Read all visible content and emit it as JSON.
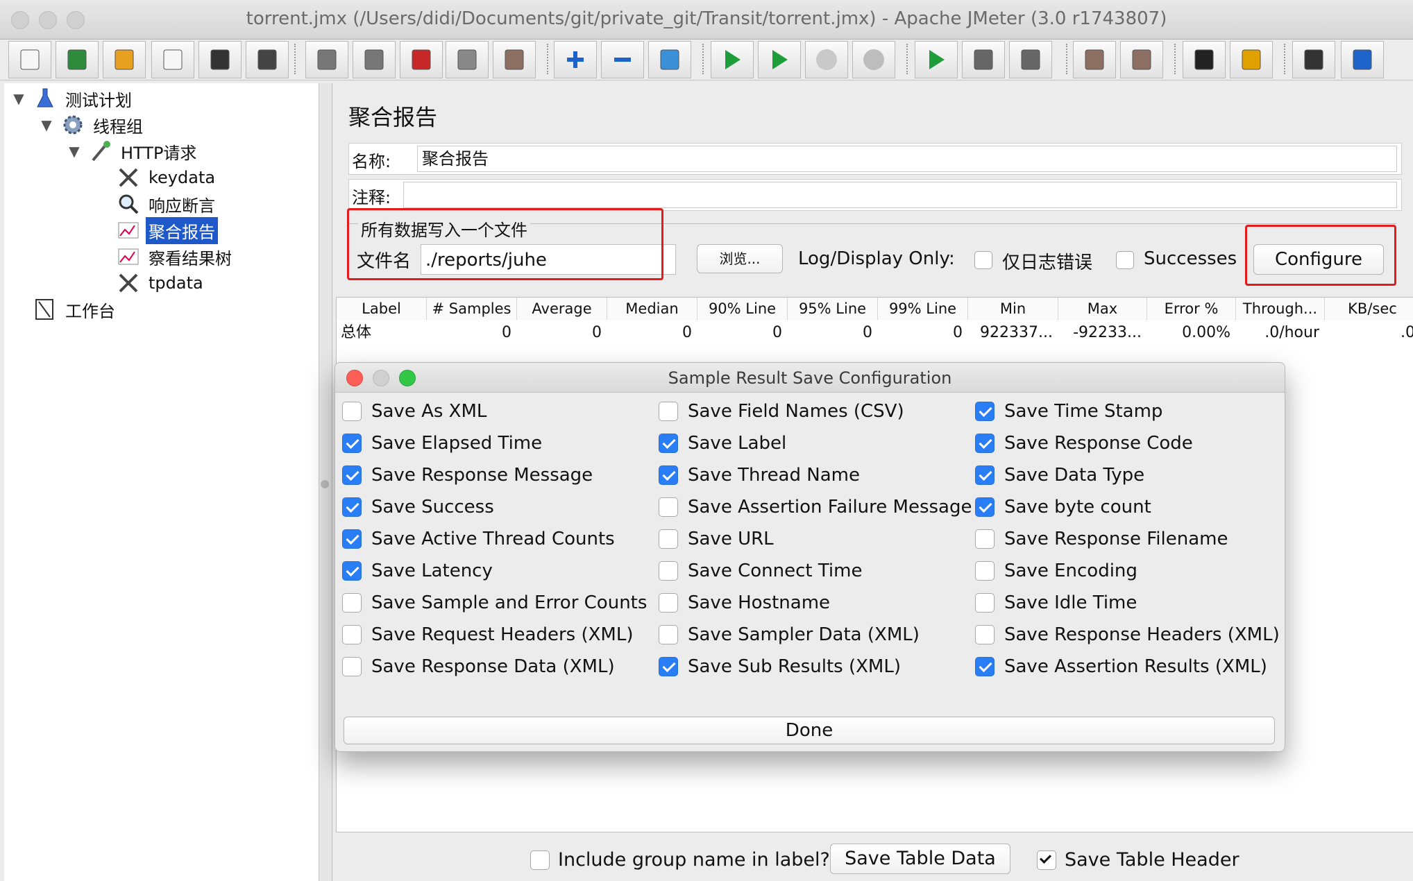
{
  "window": {
    "title": "torrent.jmx (/Users/didi/Documents/git/private_git/Transit/torrent.jmx) - Apache JMeter (3.0 r1743807)"
  },
  "toolbar": [
    {
      "name": "new-icon"
    },
    {
      "name": "templates-icon"
    },
    {
      "name": "open-icon"
    },
    {
      "name": "close-icon"
    },
    {
      "name": "save-icon"
    },
    {
      "name": "save-as-icon"
    },
    {
      "name": "undo-icon"
    },
    {
      "name": "redo-icon"
    },
    {
      "name": "cut-icon"
    },
    {
      "name": "copy-icon"
    },
    {
      "name": "paste-icon"
    },
    {
      "name": "expand-icon"
    },
    {
      "name": "collapse-icon"
    },
    {
      "name": "toggle-icon"
    },
    {
      "name": "start-icon"
    },
    {
      "name": "start-no-pause-icon"
    },
    {
      "name": "stop-icon"
    },
    {
      "name": "shutdown-icon"
    },
    {
      "name": "remote-start-icon"
    },
    {
      "name": "remote-stop-icon"
    },
    {
      "name": "remote-shutdown-icon"
    },
    {
      "name": "clear-icon"
    },
    {
      "name": "clear-all-icon"
    },
    {
      "name": "search-icon"
    },
    {
      "name": "reset-search-icon"
    },
    {
      "name": "function-helper-icon"
    },
    {
      "name": "help-icon"
    }
  ],
  "tree": {
    "items": [
      {
        "label": "测试计划",
        "icon": "test-plan-icon",
        "expanded": true
      },
      {
        "label": "线程组",
        "icon": "thread-group-icon",
        "expanded": true
      },
      {
        "label": "HTTP请求",
        "icon": "http-sampler-icon",
        "expanded": true
      },
      {
        "label": "keydata",
        "icon": "tools-icon"
      },
      {
        "label": "响应断言",
        "icon": "magnifier-icon"
      },
      {
        "label": "聚合报告",
        "icon": "graph-icon",
        "selected": true
      },
      {
        "label": "察看结果树",
        "icon": "graph-icon"
      },
      {
        "label": "tpdata",
        "icon": "tools-icon"
      },
      {
        "label": "工作台",
        "icon": "workbench-icon"
      }
    ]
  },
  "panel": {
    "title": "聚合报告",
    "name_label": "名称:",
    "name_value": "聚合报告",
    "comment_label": "注释:",
    "comment_value": "",
    "file_group_legend": "所有数据写入一个文件",
    "filename_label": "文件名",
    "filename_value": "./reports/juhe",
    "browse_label": "浏览...",
    "log_display_label": "Log/Display Only:",
    "errors_only_label": "仅日志错误",
    "successes_label": "Successes",
    "configure_label": "Configure"
  },
  "table": {
    "headers": [
      "Label",
      "# Samples",
      "Average",
      "Median",
      "90% Line",
      "95% Line",
      "99% Line",
      "Min",
      "Max",
      "Error %",
      "Through...",
      "KB/sec"
    ],
    "rows": [
      [
        "总体",
        "0",
        "0",
        "0",
        "0",
        "0",
        "0",
        "922337...",
        "-92233...",
        "0.00%",
        ".0/hour",
        ".0"
      ]
    ]
  },
  "dialog": {
    "title": "Sample Result Save Configuration",
    "options": [
      {
        "label": "Save As XML",
        "checked": false
      },
      {
        "label": "Save Field Names (CSV)",
        "checked": false
      },
      {
        "label": "Save Time Stamp",
        "checked": true
      },
      {
        "label": "Save Elapsed Time",
        "checked": true
      },
      {
        "label": "Save Label",
        "checked": true
      },
      {
        "label": "Save Response Code",
        "checked": true
      },
      {
        "label": "Save Response Message",
        "checked": true
      },
      {
        "label": "Save Thread Name",
        "checked": true
      },
      {
        "label": "Save Data Type",
        "checked": true
      },
      {
        "label": "Save Success",
        "checked": true
      },
      {
        "label": "Save Assertion Failure Message",
        "checked": false
      },
      {
        "label": "Save byte count",
        "checked": true
      },
      {
        "label": "Save Active Thread Counts",
        "checked": true
      },
      {
        "label": "Save URL",
        "checked": false
      },
      {
        "label": "Save Response Filename",
        "checked": false
      },
      {
        "label": "Save Latency",
        "checked": true
      },
      {
        "label": "Save Connect Time",
        "checked": false
      },
      {
        "label": "Save Encoding",
        "checked": false
      },
      {
        "label": "Save Sample and Error Counts",
        "checked": false
      },
      {
        "label": "Save Hostname",
        "checked": false
      },
      {
        "label": "Save Idle Time",
        "checked": false
      },
      {
        "label": "Save Request Headers (XML)",
        "checked": false
      },
      {
        "label": "Save Sampler Data (XML)",
        "checked": false
      },
      {
        "label": "Save Response Headers (XML)",
        "checked": false
      },
      {
        "label": "Save Response Data (XML)",
        "checked": false
      },
      {
        "label": "Save Sub Results (XML)",
        "checked": true
      },
      {
        "label": "Save Assertion Results (XML)",
        "checked": true
      }
    ],
    "done_label": "Done"
  },
  "footer": {
    "include_group_label": "Include group name in label?",
    "include_group_checked": false,
    "save_table_data_label": "Save Table Data",
    "save_table_header_label": "Save Table Header",
    "save_table_header_checked": true
  },
  "colors": {
    "selection": "#1f58c9",
    "highlight_border": "#e01c1c",
    "checkbox_on": "#2a7ef5"
  }
}
